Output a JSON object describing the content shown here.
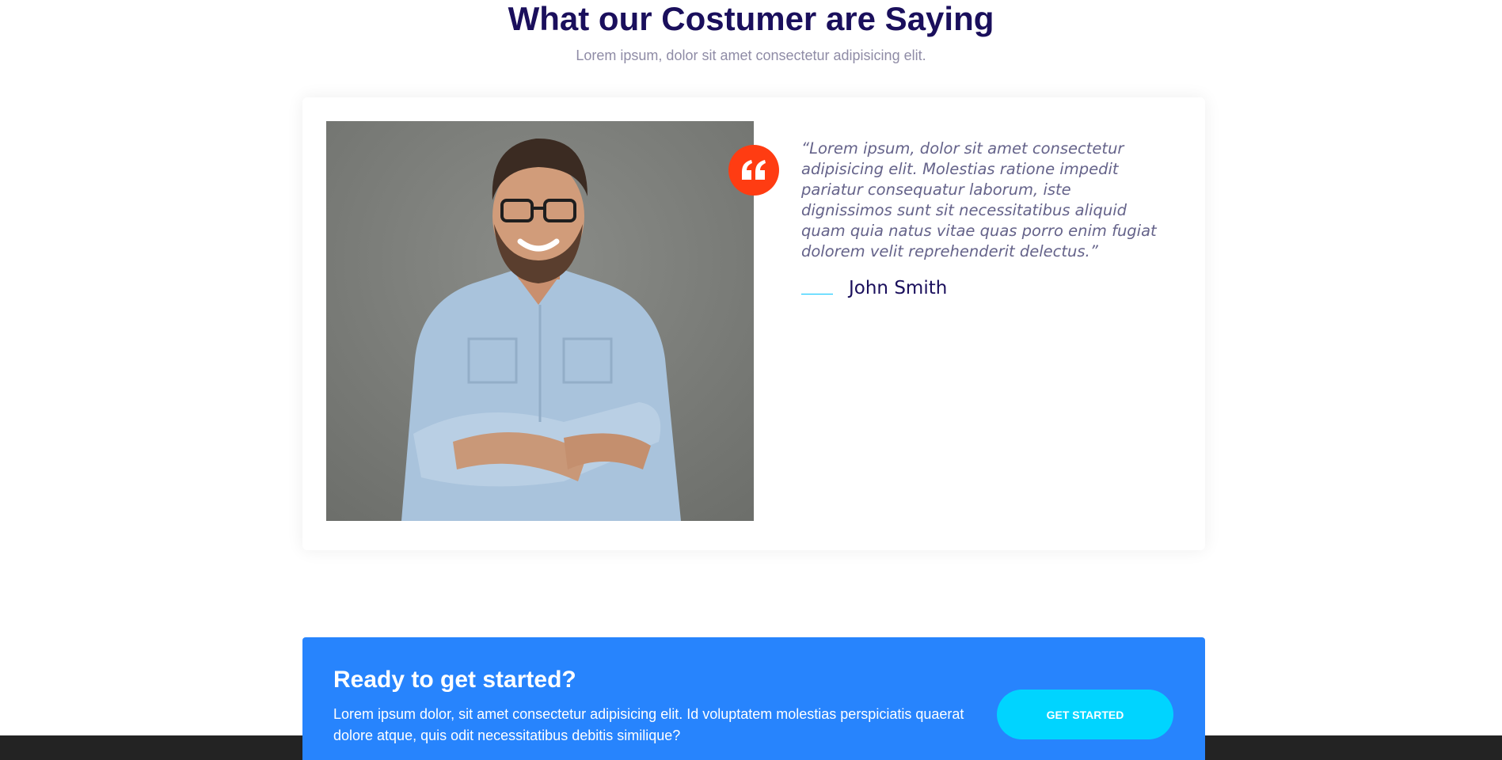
{
  "testimonials": {
    "title": "What our Costumer are Saying",
    "subtitle": "Lorem ipsum, dolor sit amet consectetur adipisicing elit.",
    "quote": "“Lorem ipsum, dolor sit amet consectetur adipisicing elit. Molestias ratione impedit pariatur consequatur laborum, iste dignissimos sunt sit necessitatibus aliquid quam quia natus vitae quas porro enim fugiat dolorem velit reprehenderit delectus.”",
    "author": "John Smith",
    "photo_icon": "customer-photo",
    "quote_icon": "quote-icon"
  },
  "cta": {
    "title": "Ready to get started?",
    "text": "Lorem ipsum dolor, sit amet consectetur adipisicing elit. Id voluptatem molestias perspiciatis quaerat dolore atque, quis odit necessitatibus debitis similique?",
    "button_label": "GET STARTED"
  },
  "colors": {
    "heading": "#1a0f5c",
    "accent_quote": "#ff3c12",
    "cta_background": "#2784fd",
    "cta_button": "#00d4ff",
    "author_line": "#00c4ff",
    "footer": "#232323"
  }
}
